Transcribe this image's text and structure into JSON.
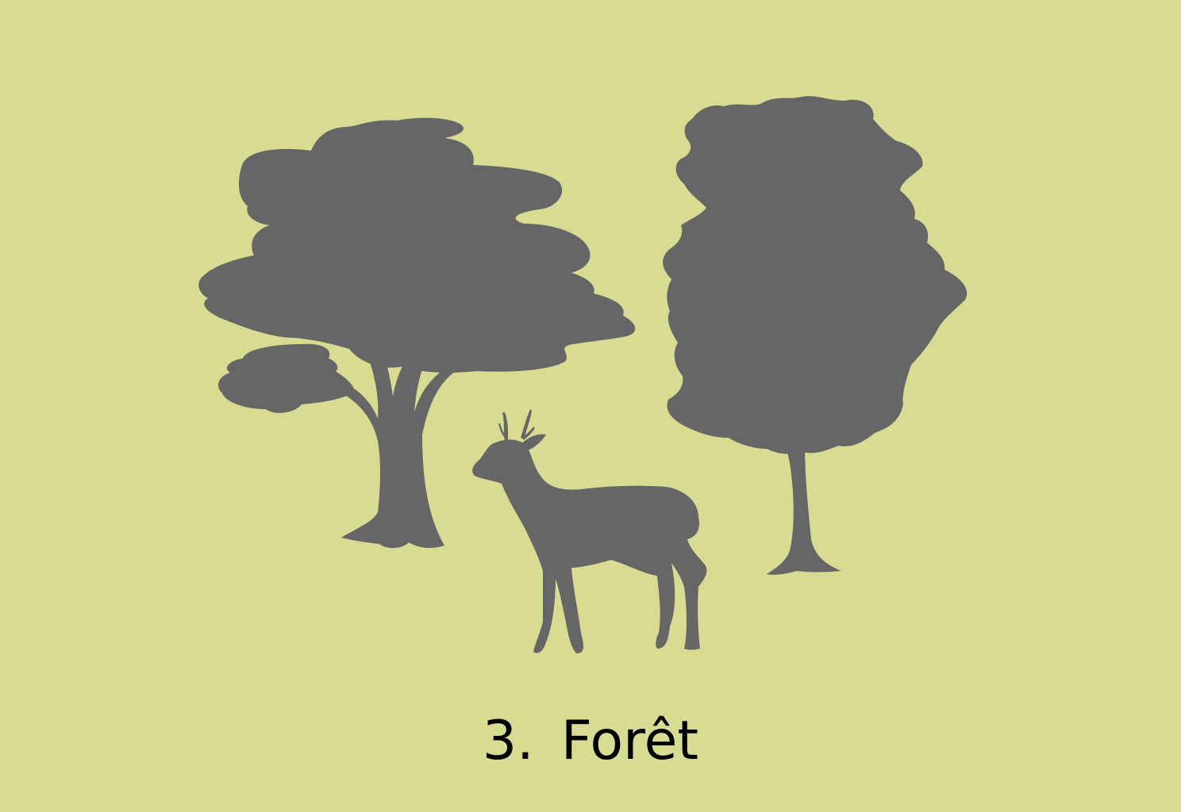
{
  "colors": {
    "background": "#d8dc93",
    "silhouette": "#666666",
    "text": "#000000"
  },
  "illustration": {
    "icons": [
      "umbrella-tree-icon",
      "leafy-tree-icon",
      "deer-icon"
    ]
  },
  "caption": {
    "number": "3.",
    "title": "Forêt"
  }
}
